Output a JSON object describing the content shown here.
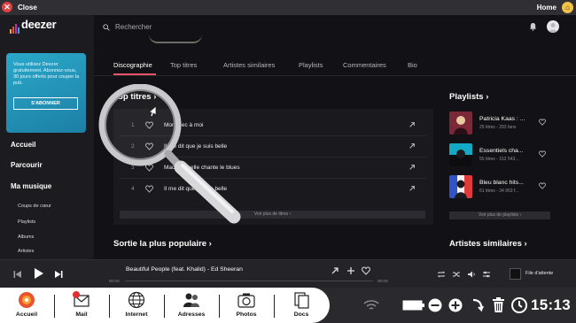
{
  "window": {
    "close_label": "Close",
    "home_label": "Home"
  },
  "brand": {
    "name": "deezer",
    "accent": "#ef5466",
    "promo_color": "#1f8fb3"
  },
  "promo": {
    "text": "Vous utilisez Deezer gratuitement. Abonnez-vous, 30 jours offerts pour couper la pub.",
    "button": "S'ABONNER"
  },
  "sidebar": {
    "main": [
      "Accueil",
      "Parcourir",
      "Ma musique"
    ],
    "sub": [
      "Coups de cœur",
      "Playlists",
      "Albums",
      "Artistes"
    ]
  },
  "search": {
    "placeholder": "Rechercher"
  },
  "tabs": [
    {
      "label": "Discographie",
      "active": true
    },
    {
      "label": "Top titres",
      "active": false
    },
    {
      "label": "Artistes similaires",
      "active": false
    },
    {
      "label": "Playlists",
      "active": false
    },
    {
      "label": "Commentaires",
      "active": false
    },
    {
      "label": "Bio",
      "active": false
    }
  ],
  "top_titles": {
    "heading": "Top titres ›",
    "tracks": [
      {
        "num": "1",
        "title": "Mon mec à moi"
      },
      {
        "num": "2",
        "title": "Il me dit que je suis belle"
      },
      {
        "num": "3",
        "title": "Mademoiselle chante le blues"
      },
      {
        "num": "4",
        "title": "Il me dit que je suis belle"
      }
    ],
    "see_more": "Voir plus de titres ›"
  },
  "popular": {
    "heading": "Sortie la plus populaire ›"
  },
  "playlists": {
    "heading": "Playlists ›",
    "items": [
      {
        "name": "Patricia Kaas : ...",
        "meta": "25 titres - 293 fans",
        "thumb_color": "#7b2838"
      },
      {
        "name": "Essentiels cha...",
        "meta": "55 titres - 152 543...",
        "thumb_color": "#12a9c4"
      },
      {
        "name": "Bleu blanc hits...",
        "meta": "61 titres - 34 953 f...",
        "thumb_color": "#2f54c8"
      }
    ],
    "see_more": "Voir plus de playlists ›"
  },
  "similar": {
    "heading": "Artistes similaires ›"
  },
  "player": {
    "track": "Beautiful People (feat. Khalid) - Ed Sheeran",
    "time_elapsed": "00:00",
    "time_total": "00:00",
    "progress": 0,
    "queue_label": "File d'attente"
  },
  "taskbar": {
    "items": [
      "Accueil",
      "Mail",
      "Internet",
      "Adresses",
      "Photos",
      "Docs"
    ],
    "mail_badge": "",
    "clock": "15:13"
  }
}
